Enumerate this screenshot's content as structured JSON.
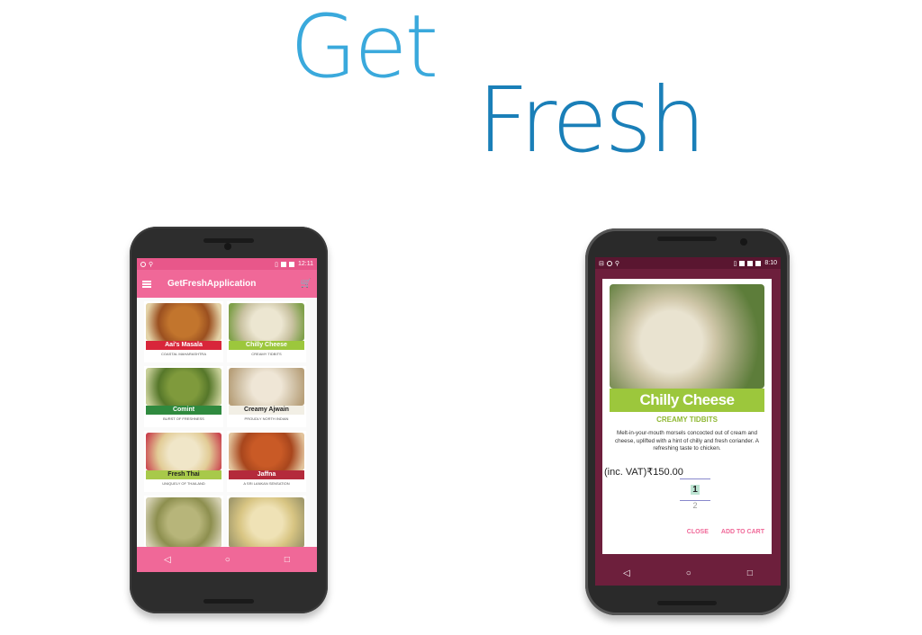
{
  "headline": {
    "line1": "Get",
    "line2": "Fresh"
  },
  "left_phone": {
    "status_time": "12:11",
    "app_title": "GetFreshApplication",
    "tiles": [
      {
        "name": "Aai's Masala",
        "tag": "COASTAL MAHARASHTRA",
        "color": "#d8263a"
      },
      {
        "name": "Chilly Cheese",
        "tag": "CREAMY TIDBITS",
        "color": "#9cc73c"
      },
      {
        "name": "Comint",
        "tag": "BURST OF FRESHNESS",
        "color": "#2f8a3f"
      },
      {
        "name": "Creamy Ajwain",
        "tag": "PROUDLY NORTH INDIAN",
        "color": "#f2efe5"
      },
      {
        "name": "Fresh Thai",
        "tag": "UNIQUELY OF THAILAND",
        "color": "#a8c94a"
      },
      {
        "name": "Jaffna",
        "tag": "A SRI LANKAN SENSATION",
        "color": "#b42a3b"
      },
      {
        "name": "",
        "tag": "",
        "color": "#e6c05a"
      },
      {
        "name": "",
        "tag": "",
        "color": "#e6c05a"
      }
    ]
  },
  "right_phone": {
    "status_time": "8:10",
    "dialog": {
      "title": "Chilly Cheese",
      "subtitle": "CREAMY TIDBITS",
      "description": "Melt-in-your-mouth morsels concocted out of cream and cheese, uplifted with a hint of chilly and fresh coriander. A refreshing taste to chicken.",
      "price": "(inc. VAT)₹150.00",
      "quantity_selected": "1",
      "quantity_next": "2",
      "close_label": "CLOSE",
      "add_label": "ADD TO CART"
    }
  },
  "nav": {
    "back": "◁",
    "home": "○",
    "recents": "□"
  }
}
